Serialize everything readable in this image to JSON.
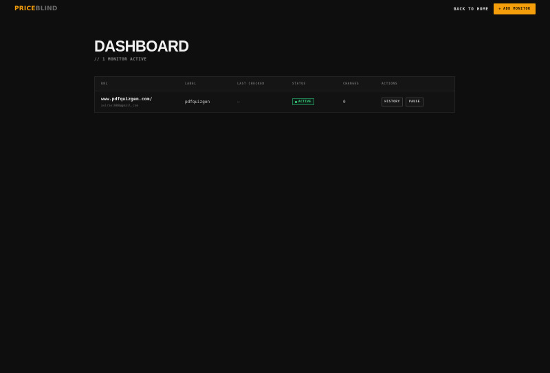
{
  "header": {
    "logo_primary": "PRICE",
    "logo_secondary": "BLIND",
    "back_link": "BACK TO HOME",
    "add_button_icon": "+",
    "add_button_label": "ADD MONITOR"
  },
  "main": {
    "title": "DASHBOARD",
    "subtitle": "// 1 MONITOR ACTIVE"
  },
  "table": {
    "columns": [
      "URL",
      "LABEL",
      "LAST CHECKED",
      "STATUS",
      "CHANGES",
      "ACTIONS"
    ],
    "rows": [
      {
        "url": "www.pdfquizgen.com/",
        "email": "avirani008@gmail.com",
        "label": "pdfquizgen",
        "last_checked": "—",
        "status": "ACTIVE",
        "changes": "0",
        "actions": [
          "HISTORY",
          "PAUSE"
        ]
      }
    ]
  },
  "colors": {
    "accent": "#f59e0b",
    "background": "#0e0e0e",
    "status_active": "#3ddc84"
  }
}
